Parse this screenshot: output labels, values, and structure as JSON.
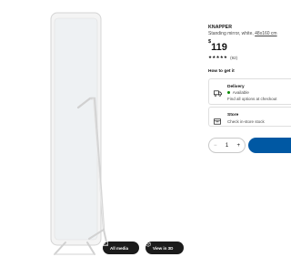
{
  "product": {
    "name": "KNAPPER",
    "description": "Standing mirror, white,",
    "dimensions": "48x160 cm",
    "currency": "$",
    "price": "119",
    "stars": "★★★★★",
    "rating_count": "(92)"
  },
  "how_to_get": {
    "heading": "How to get it",
    "delivery": {
      "title": "Delivery",
      "status": "Available",
      "note": "Find all options at checkout",
      "status_color": "#0a8a00"
    },
    "store": {
      "title": "Store",
      "note": "Check in-store stock"
    }
  },
  "quantity": {
    "minus": "−",
    "value": "1",
    "plus": "+"
  },
  "media": {
    "all_media_label": "All media",
    "view_3d_label": "View in 3D"
  },
  "colors": {
    "accent": "#0058a3",
    "frame": "#f3f3f3",
    "frame_edge": "#d6d6d6"
  }
}
